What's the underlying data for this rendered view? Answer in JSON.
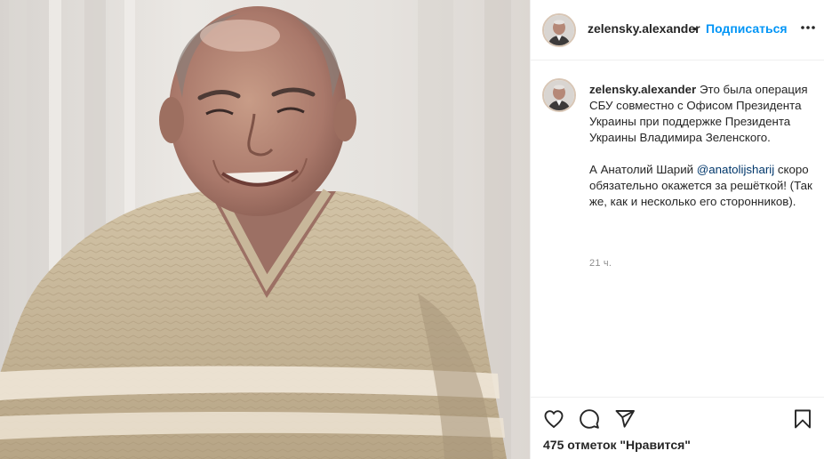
{
  "header": {
    "username": "zelensky.alexander",
    "separator": "•",
    "follow_label": "Подписаться",
    "more_icon": "more-horizontal-icon"
  },
  "caption": {
    "username": "zelensky.alexander",
    "text_part1": " Это была операция СБУ совместно с Офисом Президента Украины при поддержке Президента Украины Владимира Зеленского.",
    "text_part2_before": "А Анатолий Шарий ",
    "mention": "@anatolijsharij",
    "text_part2_after": " скоро обязательно окажется за решёткой! (Так же, как и несколько его сторонников).",
    "time": "21 ч."
  },
  "actions": {
    "like_icon": "heart-icon",
    "comment_icon": "comment-icon",
    "share_icon": "paper-plane-icon",
    "save_icon": "bookmark-icon"
  },
  "likes_text": "475 отметок \"Нравится\"",
  "colors": {
    "link": "#0095f6",
    "mention": "#00376b",
    "text": "#262626",
    "muted": "#8e8e8e",
    "divider": "#efefef"
  }
}
